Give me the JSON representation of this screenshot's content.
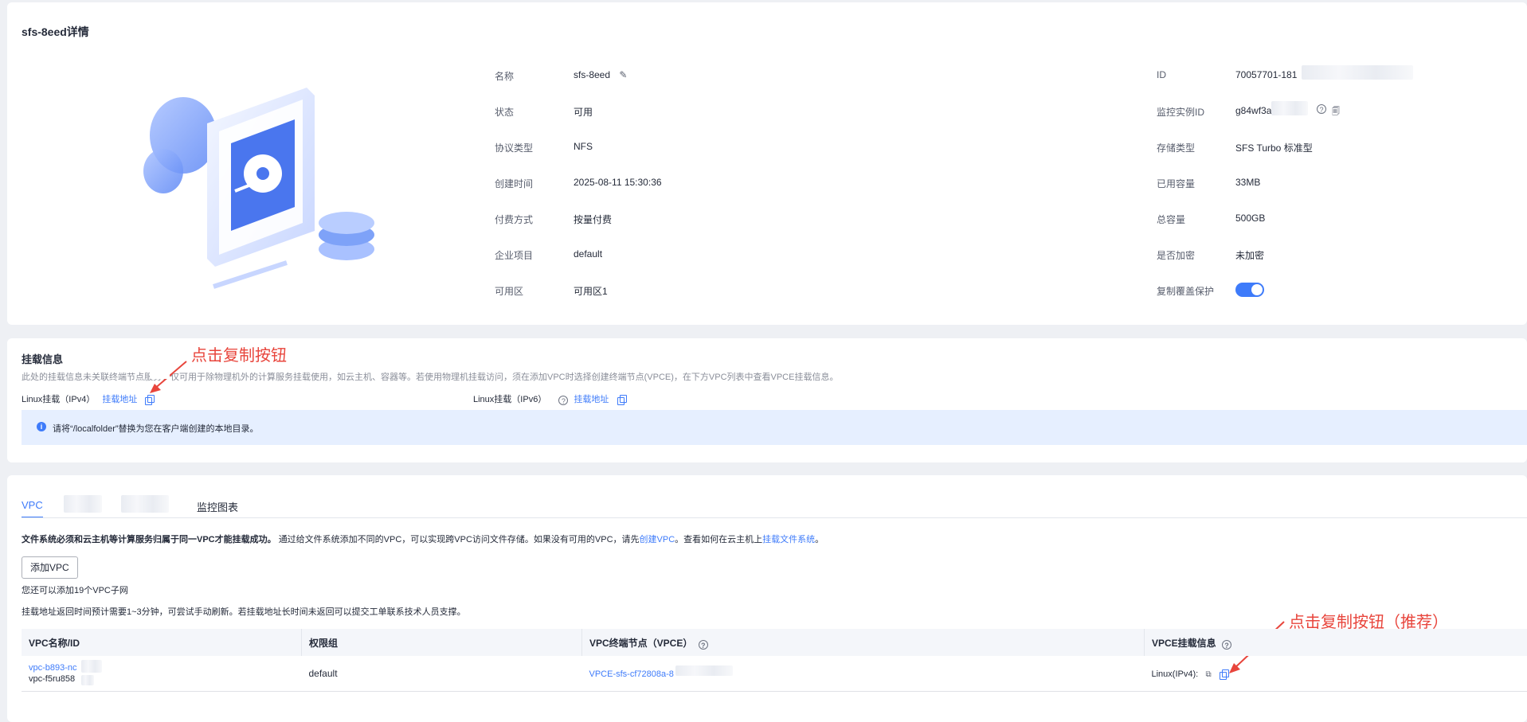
{
  "detail": {
    "title": "sfs-8eed详情",
    "left_fields": [
      {
        "label": "名称",
        "value": "sfs-8eed"
      },
      {
        "label": "状态",
        "value": "可用"
      },
      {
        "label": "协议类型",
        "value": "NFS"
      },
      {
        "label": "创建时间",
        "value": "2025-08-11 15:30:36"
      },
      {
        "label": "付费方式",
        "value": "按量付费"
      },
      {
        "label": "企业项目",
        "value": "default"
      },
      {
        "label": "可用区",
        "value": "可用区1"
      }
    ],
    "right_fields": [
      {
        "label": "ID",
        "value": "70057701-181"
      },
      {
        "label": "监控实例ID",
        "value": "g84wf3av"
      },
      {
        "label": "存储类型",
        "value": "SFS Turbo 标准型"
      },
      {
        "label": "已用容量",
        "value": "33MB"
      },
      {
        "label": "总容量",
        "value": "500GB"
      },
      {
        "label": "是否加密",
        "value": "未加密"
      },
      {
        "label": "复制覆盖保护",
        "value": "on"
      }
    ],
    "toggle_state": "on"
  },
  "mount": {
    "title": "挂载信息",
    "description": "此处的挂载信息未关联终端节点服务，仅可用于除物理机外的计算服务挂载使用，如云主机、容器等。若使用物理机挂载访问，须在添加VPC时选择创建终端节点(VPCE)，在下方VPC列表中查看VPCE挂载信息。",
    "ipv4_label": "Linux挂载（IPv4）",
    "ipv4_link": "挂载地址",
    "ipv6_label": "Linux挂载（IPv6）",
    "ipv6_link": "挂载地址",
    "notice": "请将“/localfolder”替换为您在客户端创建的本地目录。",
    "annotation": "点击复制按钮"
  },
  "vpc_section": {
    "tabs": [
      "VPC",
      "监控图表"
    ],
    "info_bold": "文件系统必须和云主机等计算服务归属于同一VPC才能挂载成功。",
    "info_text1": "通过给文件系统添加不同的VPC，可以实现跨VPC访问文件存储。如果没有可用的VPC，请先",
    "info_link1": "创建VPC",
    "info_text2": "。查看如何在云主机上",
    "info_link2": "挂载文件系统",
    "info_text3": "。",
    "add_button": "添加VPC",
    "quota_text": "您还可以添加19个VPC子网",
    "hint_text": "挂载地址返回时间预计需要1~3分钟，可尝试手动刷新。若挂载地址长时间未返回可以提交工单联系技术人员支撑。",
    "annotation": "点击复制按钮（推荐）",
    "table": {
      "headers": [
        "VPC名称/ID",
        "权限组",
        "VPC终端节点（VPCE）",
        "VPCE挂载信息"
      ],
      "rows": [
        {
          "vpc_name": "vpc-b893-nc",
          "vpc_id": "vpc-f5ru858",
          "perm": "default",
          "vpce": "VPCE-sfs-cf72808a-8",
          "mount_info": "Linux(IPv4):"
        }
      ]
    }
  },
  "colors": {
    "accent": "#3e7bfa",
    "annotation": "#e8453c",
    "notice_bg": "#e6efff"
  }
}
